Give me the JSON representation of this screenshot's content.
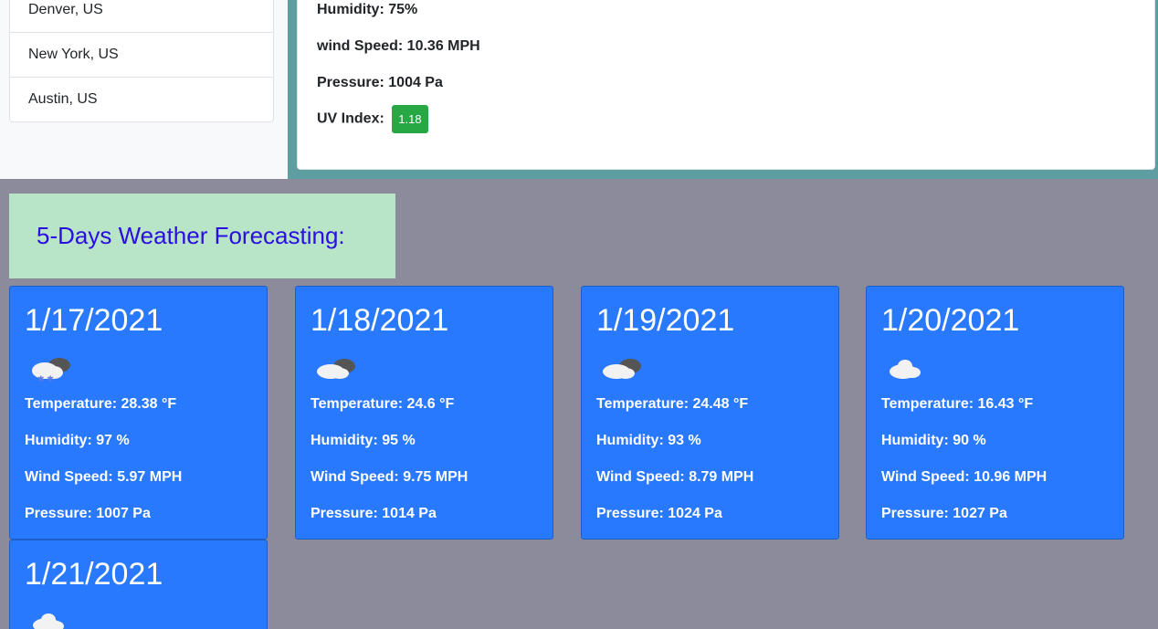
{
  "cities": [
    {
      "label": "Denver, US"
    },
    {
      "label": "New York, US"
    },
    {
      "label": "Austin, US"
    }
  ],
  "current": {
    "humidity": "Humidity: 75%",
    "wind": "wind Speed: 10.36 MPH",
    "pressure": "Pressure: 1004 Pa",
    "uv_label": "UV Index:",
    "uv_value": "1.18",
    "uv_color": "#28a745"
  },
  "forecast": {
    "title": "5-Days Weather Forecasting:",
    "days": [
      {
        "date": "1/17/2021",
        "icon": "snow-cloud-icon",
        "temp": "Temperature: 28.38 °F",
        "humidity": "Humidity: 97 %",
        "wind": "Wind Speed: 5.97 MPH",
        "pressure": "Pressure: 1007 Pa"
      },
      {
        "date": "1/18/2021",
        "icon": "broken-clouds-icon",
        "temp": "Temperature: 24.6 °F",
        "humidity": "Humidity: 95 %",
        "wind": "Wind Speed: 9.75 MPH",
        "pressure": "Pressure: 1014 Pa"
      },
      {
        "date": "1/19/2021",
        "icon": "broken-clouds-icon",
        "temp": "Temperature: 24.48 °F",
        "humidity": "Humidity: 93 %",
        "wind": "Wind Speed: 8.79 MPH",
        "pressure": "Pressure: 1024 Pa"
      },
      {
        "date": "1/20/2021",
        "icon": "cloud-icon",
        "temp": "Temperature: 16.43 °F",
        "humidity": "Humidity: 90 %",
        "wind": "Wind Speed: 10.96 MPH",
        "pressure": "Pressure: 1027 Pa"
      },
      {
        "date": "1/21/2021",
        "icon": "cloud-icon"
      }
    ]
  },
  "colors": {
    "card_bg": "#2979ff",
    "title_color": "#2a0fe0",
    "title_box_bg": "#b8e4c8",
    "panel_accent": "#5f9ea0",
    "page_bg": "#8b8b9b"
  }
}
